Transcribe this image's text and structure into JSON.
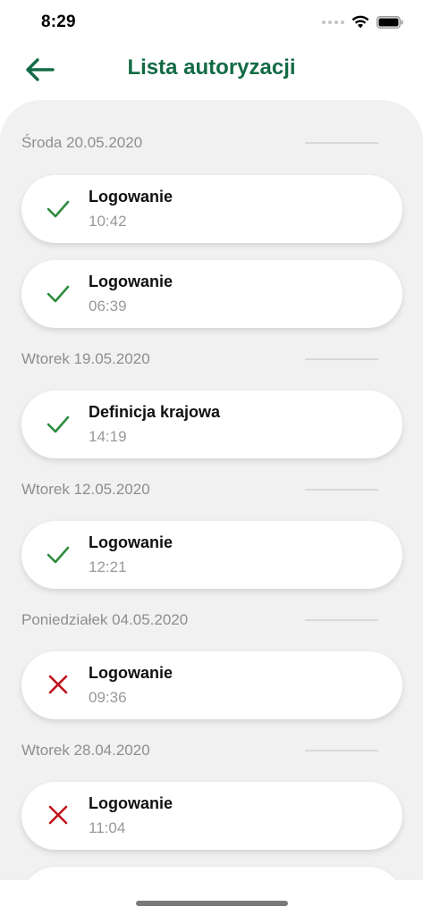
{
  "status_bar": {
    "time": "8:29"
  },
  "header": {
    "title": "Lista autoryzacji"
  },
  "colors": {
    "accent": "#136b45",
    "success": "#2e8b3e",
    "failure": "#c0131a"
  },
  "sections": [
    {
      "date": "Środa 20.05.2020",
      "items": [
        {
          "title": "Logowanie",
          "time": "10:42",
          "status": "success",
          "icon": "check-icon"
        },
        {
          "title": "Logowanie",
          "time": "06:39",
          "status": "success",
          "icon": "check-icon"
        }
      ]
    },
    {
      "date": "Wtorek 19.05.2020",
      "items": [
        {
          "title": "Definicja krajowa",
          "time": "14:19",
          "status": "success",
          "icon": "check-icon"
        }
      ]
    },
    {
      "date": "Wtorek 12.05.2020",
      "items": [
        {
          "title": "Logowanie",
          "time": "12:21",
          "status": "success",
          "icon": "check-icon"
        }
      ]
    },
    {
      "date": "Poniedziałek 04.05.2020",
      "items": [
        {
          "title": "Logowanie",
          "time": "09:36",
          "status": "failure",
          "icon": "x-icon"
        }
      ]
    },
    {
      "date": "Wtorek 28.04.2020",
      "items": [
        {
          "title": "Logowanie",
          "time": "11:04",
          "status": "failure",
          "icon": "x-icon"
        }
      ]
    }
  ]
}
